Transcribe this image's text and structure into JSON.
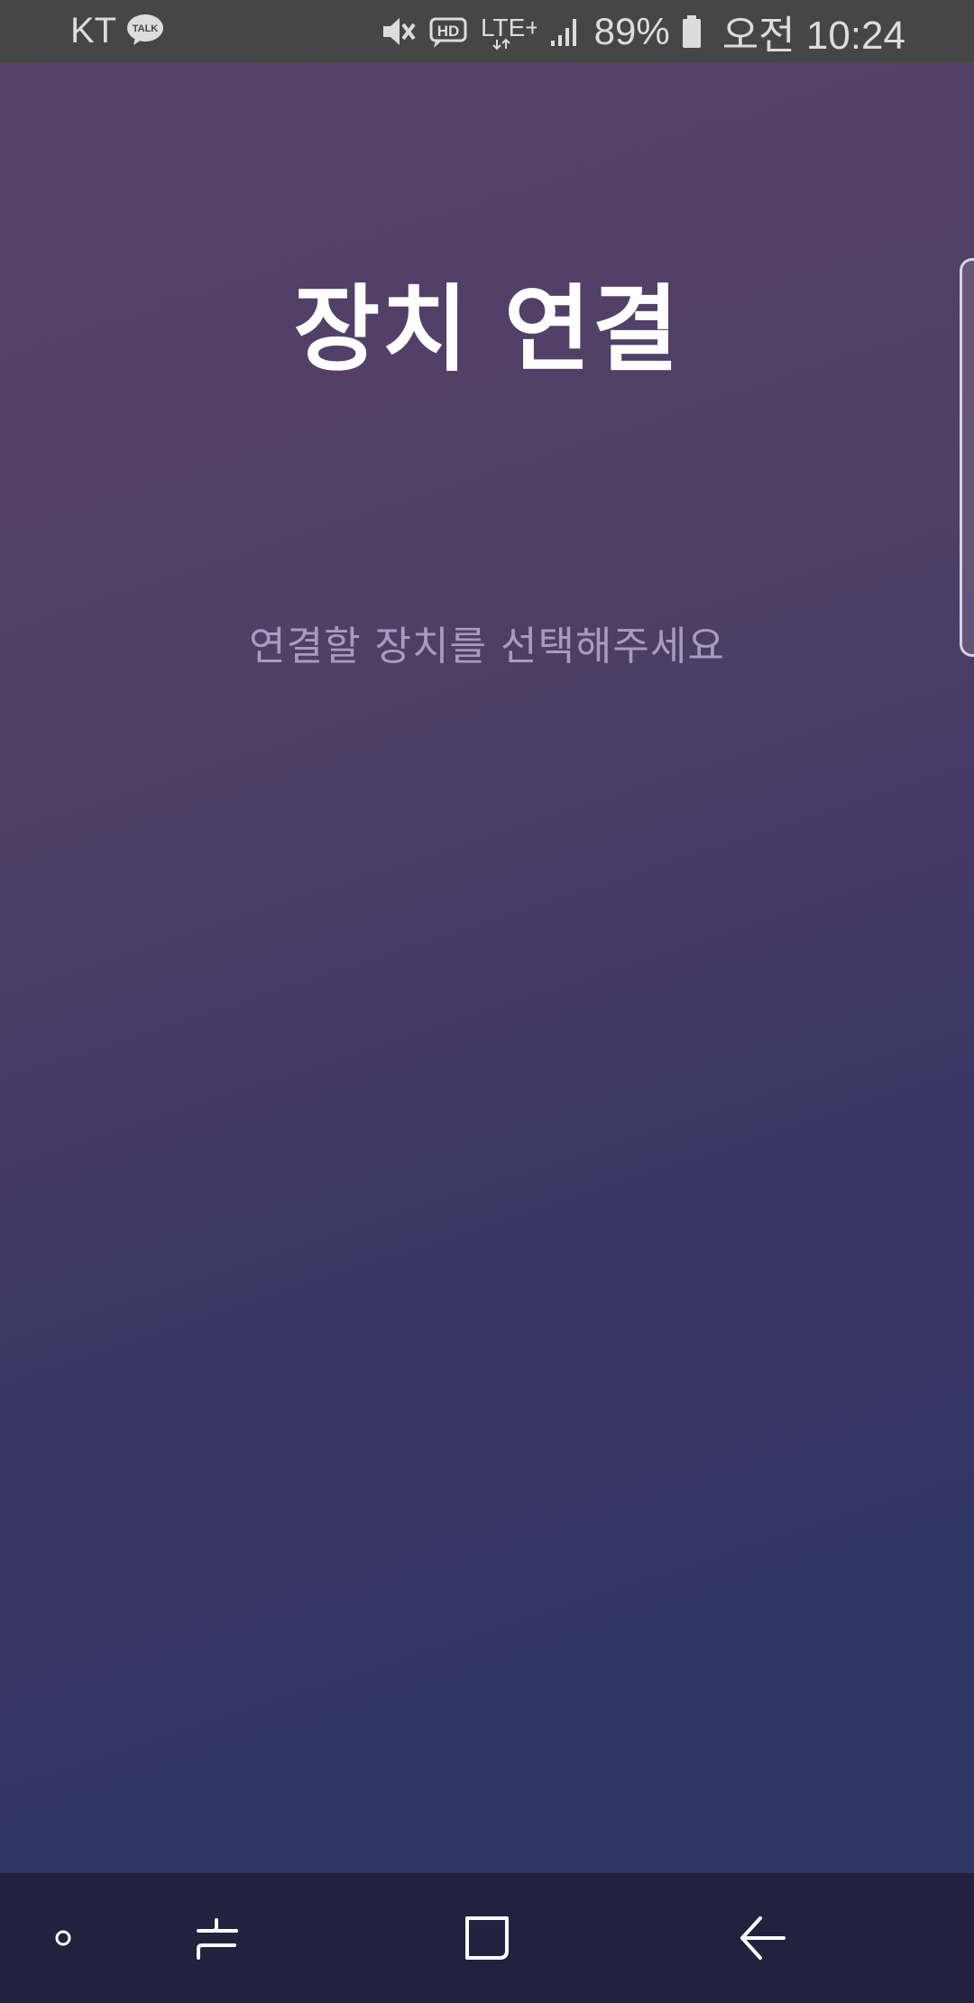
{
  "status_bar": {
    "carrier": "KT",
    "talk_badge": "TALK",
    "network": "LTE+",
    "battery_percent": "89%",
    "time": "오전 10:24",
    "icons": [
      "kakaotalk-icon",
      "mute-icon",
      "hd-voice-icon",
      "lte-plus-icon",
      "signal-icon",
      "battery-icon"
    ]
  },
  "main": {
    "title": "장치 연결",
    "instruction": "연결할 장치를 선택해주세요"
  },
  "nav_bar": {
    "icons": [
      "assistant-dot-icon",
      "recent-apps-icon",
      "home-icon",
      "back-icon"
    ]
  },
  "colors": {
    "background_top": "#56426b",
    "background_bottom": "#313667",
    "status_bar": "#464646",
    "nav_bar": "#20223e",
    "title_text": "#ffffff",
    "instruction_text": "#a99cbb"
  }
}
